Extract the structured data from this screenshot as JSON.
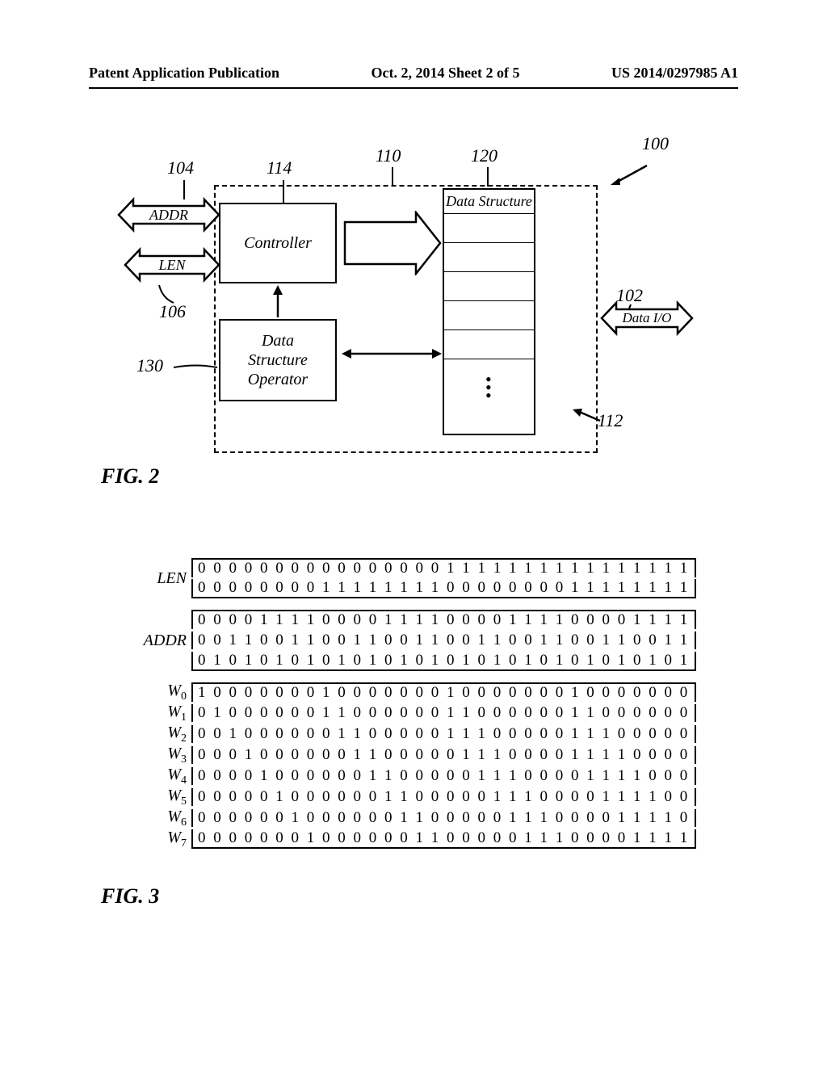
{
  "header": {
    "left": "Patent Application Publication",
    "center": "Oct. 2, 2014   Sheet 2 of 5",
    "right": "US 2014/0297985 A1"
  },
  "fig2": {
    "caption": "FIG. 2",
    "refs": {
      "r100": "100",
      "r102": "Data I/O",
      "r102num": "102",
      "r104": "ADDR",
      "r104num": "104",
      "r106": "LEN",
      "r106num": "106",
      "r110": "110",
      "r112": "112",
      "r114num": "114",
      "r120": "120",
      "r130": "130"
    },
    "controller": "Controller",
    "dso": "Data\nStructure\nOperator",
    "ds_title": "Data Structure"
  },
  "fig3": {
    "caption": "FIG. 3",
    "labels": {
      "len": "LEN",
      "addr": "ADDR",
      "w": "W"
    },
    "len": [
      "00000000000000001111111111111111",
      "00000000111111110000000011111111"
    ],
    "addr": [
      "00001111000011110000111100001111",
      "00110011001100110011001100110011",
      "01010101010101010101010101010101"
    ],
    "w": [
      "10000000100000001000000010000000",
      "01000000110000001100000011000000",
      "00100000011000001110000011100000",
      "00010000001100000111000011110000",
      "00001000000110000011100001111000",
      "00000100000011000001110000111100",
      "00000010000001100000111000011110",
      "00000001000000110000011100001111"
    ]
  }
}
